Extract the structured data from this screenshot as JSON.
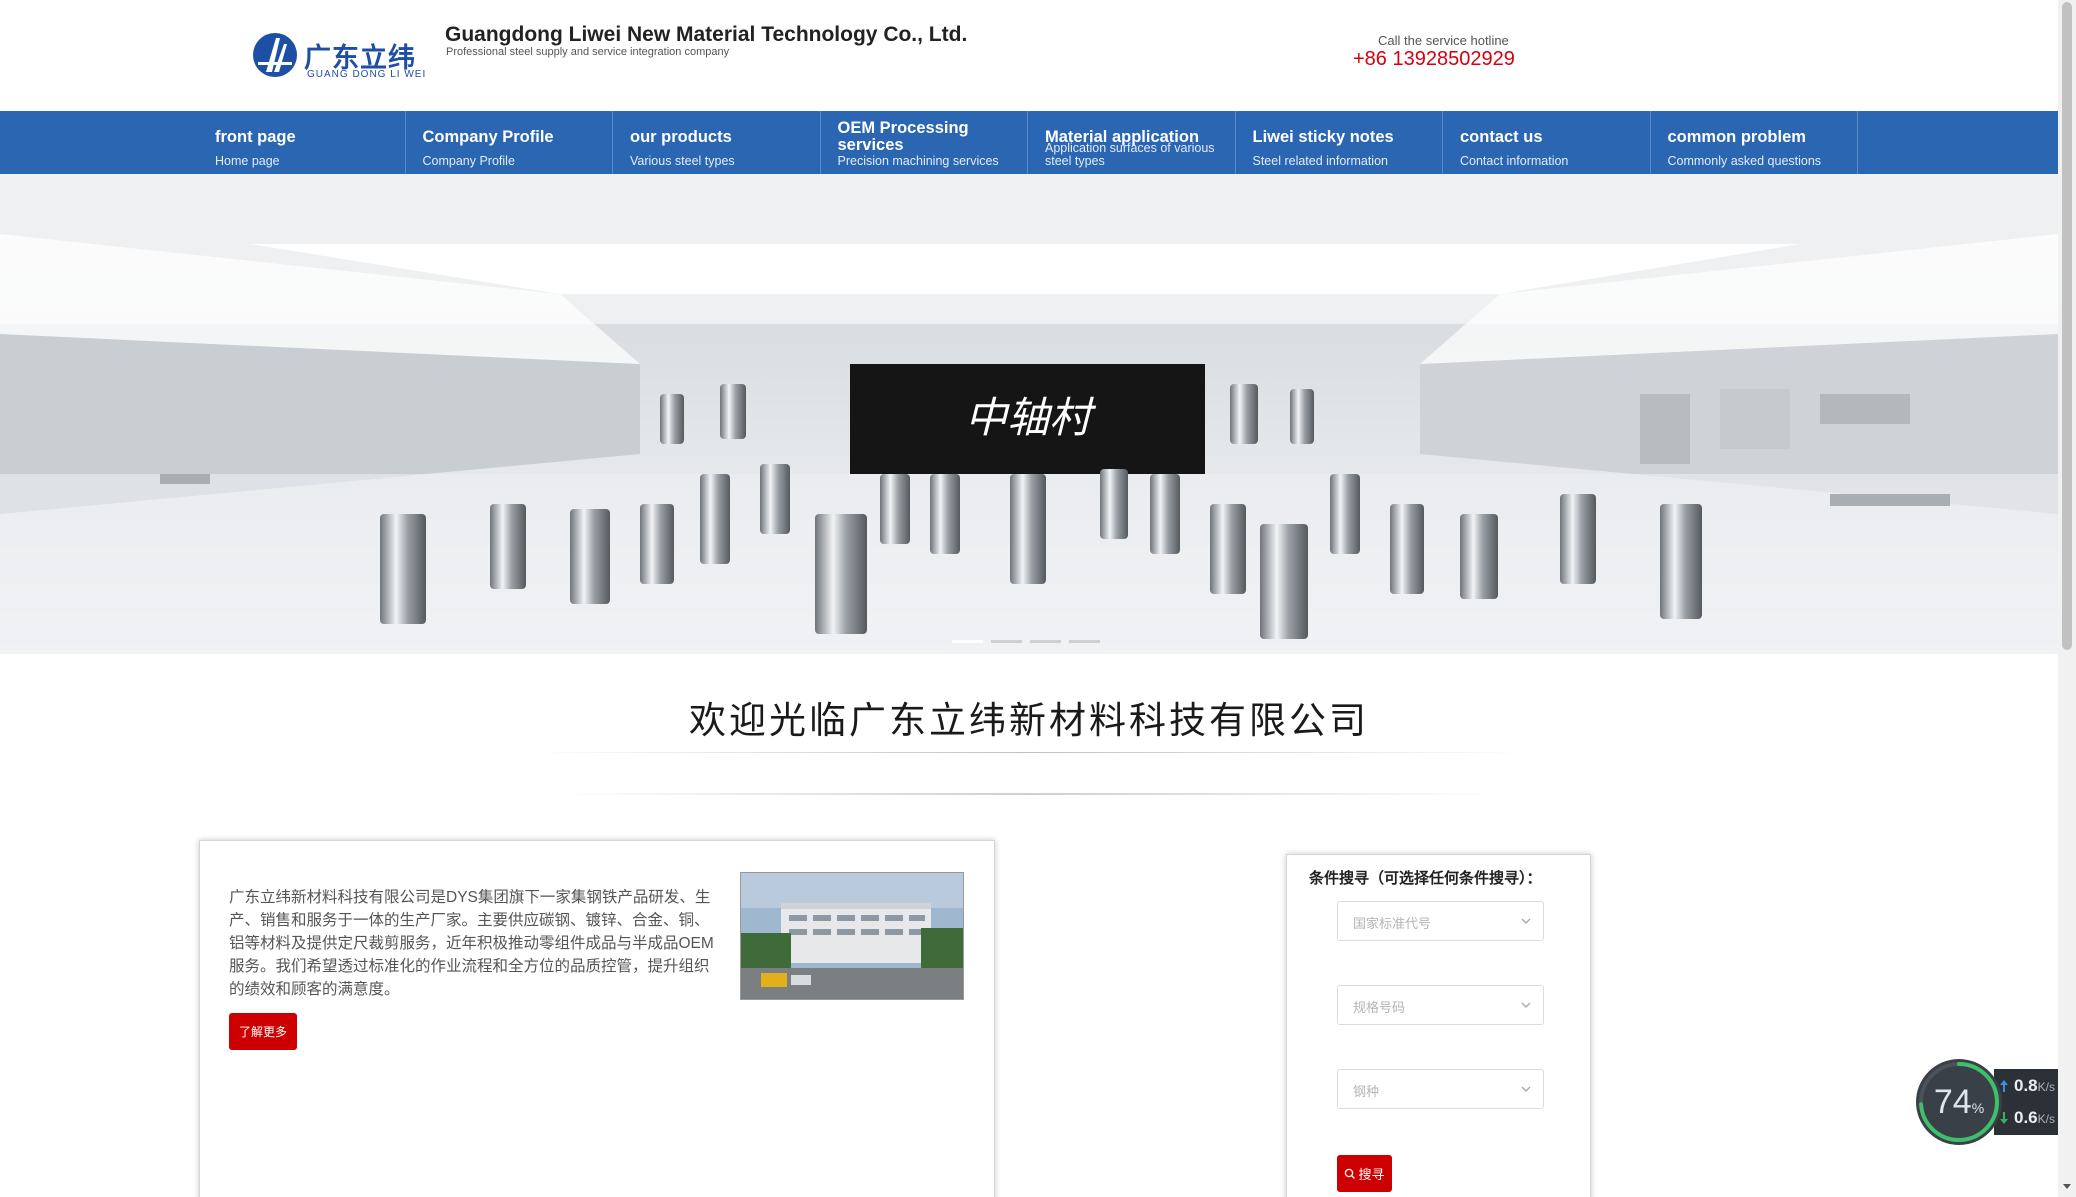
{
  "header": {
    "logo_cn": "广东立纬",
    "logo_en": "GUANG DONG LI WEI",
    "company_name": "Guangdong Liwei New Material Technology Co., Ltd.",
    "tagline": "Professional steel supply and service integration company",
    "hotline_label": "Call the service hotline",
    "hotline_number": "+86 13928502929"
  },
  "nav": {
    "items": [
      {
        "title": "front page",
        "sub": "Home page"
      },
      {
        "title": "Company Profile",
        "sub": "Company Profile"
      },
      {
        "title": "our products",
        "sub": "Various steel types"
      },
      {
        "title": "OEM Processing services",
        "sub": "Precision machining services"
      },
      {
        "title": "Material application",
        "sub": "Application surfaces of various steel types"
      },
      {
        "title": "Liwei sticky notes",
        "sub": "Steel related information"
      },
      {
        "title": "contact us",
        "sub": "Contact information"
      },
      {
        "title": "common problem",
        "sub": "Commonly asked questions"
      }
    ]
  },
  "banner": {
    "screen_text": "中轴村",
    "slide_count": 4,
    "active_slide": 1
  },
  "welcome": {
    "title": "欢迎光临广东立纬新材料科技有限公司"
  },
  "intro": {
    "text": "广东立纬新材料科技有限公司是DYS集团旗下一家集钢铁产品研发、生产、销售和服务于一体的生产厂家。主要供应碳钢、镀锌、合金、铜、铝等材料及提供定尺裁剪服务，近年积极推动零组件成品与半成品OEM服务。我们希望透过标准化的作业流程和全方位的品质控管，提升组织的绩效和顾客的满意度。",
    "more_label": "了解更多"
  },
  "search": {
    "title": "条件搜寻（可选择任何条件搜寻）：",
    "selects": [
      {
        "placeholder": "国家标准代号"
      },
      {
        "placeholder": "规格号码"
      },
      {
        "placeholder": "钢种"
      }
    ],
    "button_label": "搜寻"
  },
  "widget": {
    "percent": "74",
    "percent_unit": "%",
    "up_value": "0.8",
    "up_unit": "K/s",
    "down_value": "0.6",
    "down_unit": "K/s"
  },
  "colors": {
    "nav_bg": "#2b66b3",
    "brand_blue": "#1d4fa5",
    "accent_red": "#cc0000",
    "hotline_red": "#d6000f"
  }
}
